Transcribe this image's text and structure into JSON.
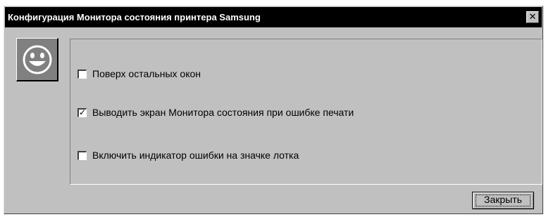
{
  "window": {
    "title": "Конфигурация Монитора состояния принтера Samsung",
    "close_glyph": "✕"
  },
  "icon": {
    "name": "smiley-face-icon"
  },
  "options": [
    {
      "label": "Поверх остальных окон",
      "checked": false
    },
    {
      "label": "Выводить экран Монитора состояния при ошибке печати",
      "checked": true
    },
    {
      "label": "Включить индикатор ошибки на значке лотка",
      "checked": false
    }
  ],
  "buttons": {
    "close_label": "Закрыть"
  },
  "check_glyph": "✓"
}
